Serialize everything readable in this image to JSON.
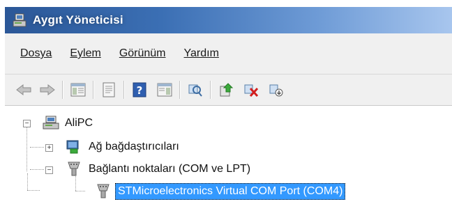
{
  "window": {
    "title": "Aygıt Yöneticisi"
  },
  "menu": {
    "items": [
      {
        "label": "Dosya"
      },
      {
        "label": "Eylem"
      },
      {
        "label": "Görünüm"
      },
      {
        "label": "Yardım"
      }
    ]
  },
  "toolbar": {
    "buttons": [
      "back-icon",
      "forward-icon",
      "show-hide-console-tree-icon",
      "properties-icon",
      "help-icon",
      "action-pane-icon",
      "scan-hardware-icon",
      "update-driver-icon",
      "uninstall-device-icon",
      "disable-device-icon"
    ]
  },
  "tree": {
    "root": {
      "label": "AliPC"
    },
    "nodes": [
      {
        "label": "Ağ bağdaştırıcıları",
        "expanded": false
      },
      {
        "label": "Bağlantı noktaları (COM ve LPT)",
        "expanded": true,
        "children": [
          {
            "label": "STMicroelectronics Virtual COM Port (COM4)",
            "selected": true
          }
        ]
      }
    ]
  },
  "colors": {
    "titlebar": "#2b5797",
    "selection": "#3399ff",
    "menubar": "#f0f0f0"
  }
}
